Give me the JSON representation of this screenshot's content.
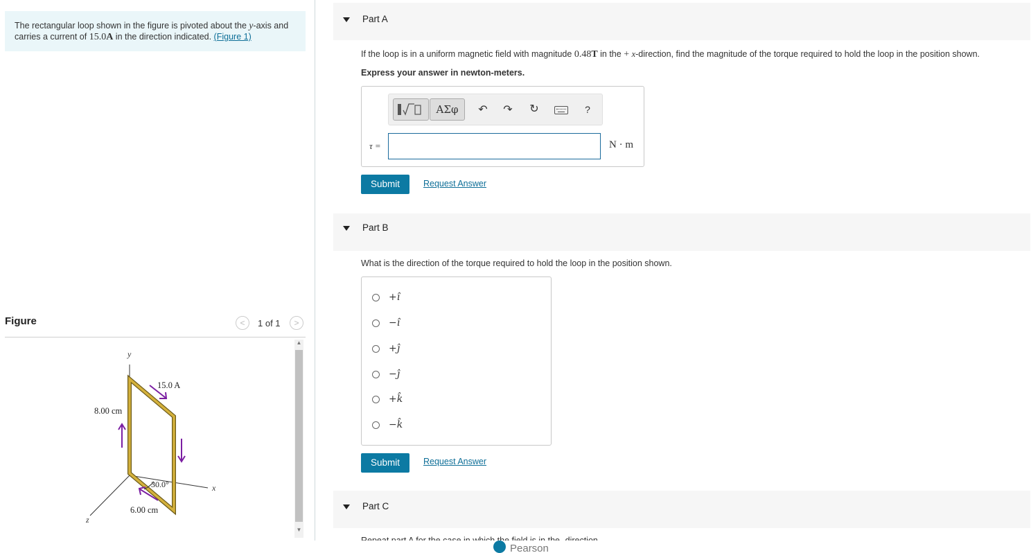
{
  "intro": {
    "text_before": "The rectangular loop shown in the figure is pivoted about the ",
    "axis_var": "y",
    "text_middle": "-axis and carries a current of ",
    "current_value": "15.0",
    "current_unit": "A",
    "text_after": " in the direction indicated. ",
    "figure_link": "(Figure 1)"
  },
  "figure_panel": {
    "title": "Figure",
    "pager": "1 of 1",
    "prev_icon": "chevron-left-icon",
    "next_icon": "chevron-right-icon",
    "labels": {
      "y_axis": "y",
      "x_axis": "x",
      "z_axis": "z",
      "current": "15.0 A",
      "height": "8.00 cm",
      "width": "6.00 cm",
      "angle": "30.0°"
    },
    "colors": {
      "loop": "#d4b13c",
      "arrows": "#7b1fa2",
      "axes": "#333333"
    }
  },
  "part_a": {
    "title": "Part A",
    "question_before": "If the loop is in a uniform magnetic field with magnitude ",
    "field_value": "0.48",
    "field_unit": "T",
    "question_middle": " in the ",
    "plus_sign": "+",
    "direction_var": "x",
    "question_after": "-direction, find the magnitude of the torque required to hold the loop in the position shown.",
    "instruction": "Express your answer in newton-meters.",
    "toolbar": {
      "template_icon": "sqrt-template-icon",
      "greek_label": "ΑΣφ",
      "undo_icon": "undo-icon",
      "redo_icon": "redo-icon",
      "reset_icon": "reset-icon",
      "keyboard_icon": "keyboard-icon",
      "help_label": "?"
    },
    "input_label": "τ =",
    "input_value": "",
    "unit": "N · m",
    "submit_label": "Submit",
    "request_label": "Request Answer"
  },
  "part_b": {
    "title": "Part B",
    "question": "What is the direction of the torque required to hold the loop in the position shown.",
    "choices": [
      "+î",
      "−î",
      "+ĵ",
      "−ĵ",
      "+k̂",
      "−k̂"
    ],
    "submit_label": "Submit",
    "request_label": "Request Answer"
  },
  "part_c": {
    "title": "Part C",
    "question_partial": "Repeat part A for the case in which the field is in the      -direction."
  },
  "footer": {
    "brand": "Pearson"
  },
  "colors": {
    "accent": "#0c7aa3",
    "intro_bg": "#eaf6f9",
    "part_band": "#f6f6f6"
  }
}
